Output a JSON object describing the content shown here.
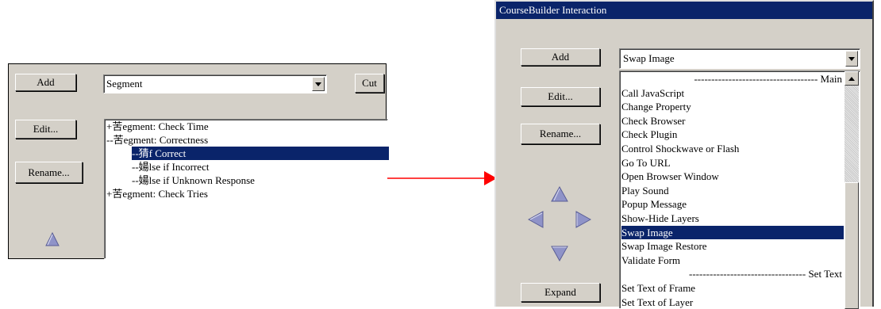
{
  "left": {
    "add_label": "Add",
    "edit_label": "Edit...",
    "rename_label": "Rename...",
    "cut_label": "Cut",
    "segment_value": "Segment",
    "tree": [
      {
        "text": "+苦egment: Check Time",
        "indent": 0,
        "selected": false
      },
      {
        "text": "--苦egment: Correctness",
        "indent": 0,
        "selected": false
      },
      {
        "text": "--猜f Correct",
        "indent": 1,
        "selected": true
      },
      {
        "text": "--婸lse if Incorrect",
        "indent": 1,
        "selected": false
      },
      {
        "text": "--婸lse if Unknown Response",
        "indent": 1,
        "selected": false
      },
      {
        "text": "+苦egment: Check Tries",
        "indent": 0,
        "selected": false
      }
    ]
  },
  "dialog": {
    "title": "CourseBuilder Interaction",
    "add_label": "Add",
    "edit_label": "Edit...",
    "rename_label": "Rename...",
    "expand_label": "Expand",
    "dropdown_value": "Swap Image",
    "items": [
      {
        "text": "------------------------------------ Main",
        "type": "sep"
      },
      {
        "text": "Call JavaScript",
        "type": "item"
      },
      {
        "text": "Change Property",
        "type": "item"
      },
      {
        "text": "Check Browser",
        "type": "item"
      },
      {
        "text": "Check Plugin",
        "type": "item"
      },
      {
        "text": "Control Shockwave or Flash",
        "type": "item"
      },
      {
        "text": "Go To URL",
        "type": "item"
      },
      {
        "text": "Open Browser Window",
        "type": "item"
      },
      {
        "text": "Play Sound",
        "type": "item"
      },
      {
        "text": "Popup Message",
        "type": "item"
      },
      {
        "text": "Show-Hide Layers",
        "type": "item"
      },
      {
        "text": "Swap Image",
        "type": "selected"
      },
      {
        "text": "Swap Image Restore",
        "type": "item"
      },
      {
        "text": "Validate Form",
        "type": "item"
      },
      {
        "text": "---------------------------------- Set Text",
        "type": "sep"
      },
      {
        "text": "Set Text of Frame",
        "type": "item"
      },
      {
        "text": "Set Text of Layer",
        "type": "item"
      }
    ]
  },
  "colors": {
    "face": "#d4d0c8",
    "selection": "#0a246a",
    "arrow": "#ff0000",
    "nav_arrow": "#8f93c8"
  },
  "icons": [
    "dropdown-arrow-icon",
    "up-arrow-icon",
    "left-arrow-icon",
    "right-arrow-icon",
    "down-arrow-icon",
    "scroll-up-icon"
  ]
}
